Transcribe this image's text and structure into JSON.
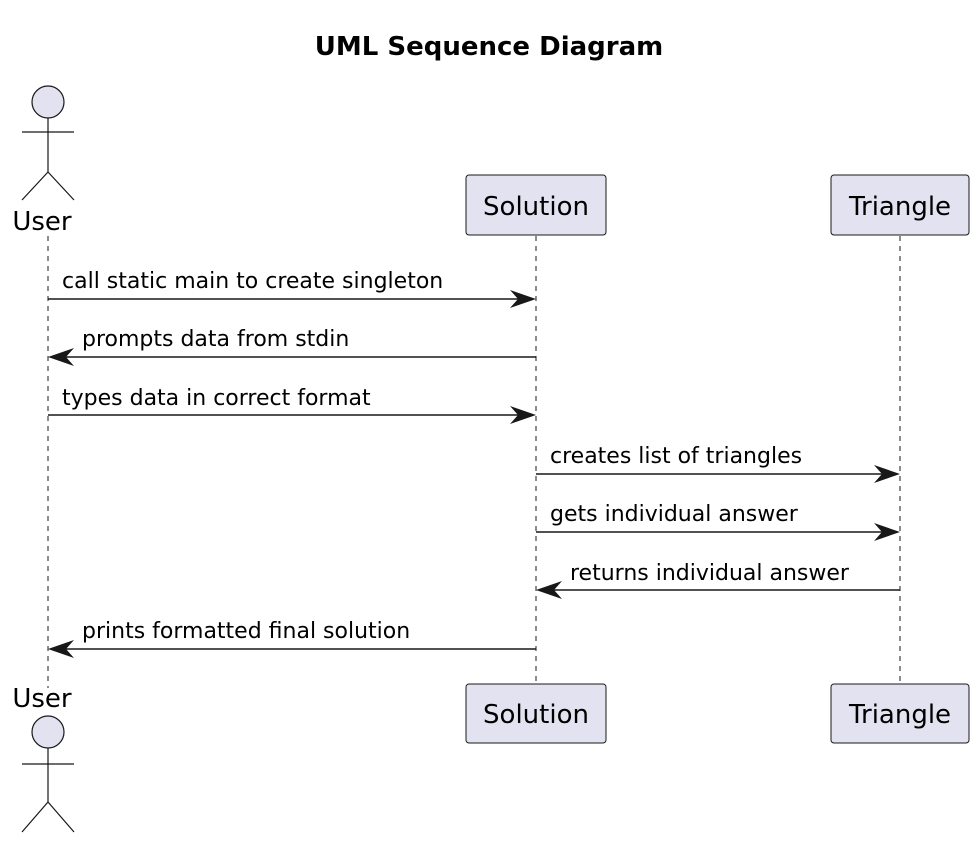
{
  "title": "UML Sequence Diagram",
  "participants": [
    {
      "id": "user",
      "label": "User",
      "kind": "actor"
    },
    {
      "id": "solution",
      "label": "Solution",
      "kind": "participant"
    },
    {
      "id": "triangle",
      "label": "Triangle",
      "kind": "participant"
    }
  ],
  "messages": [
    {
      "from": "user",
      "to": "solution",
      "label": "call static main to create singleton"
    },
    {
      "from": "solution",
      "to": "user",
      "label": "prompts data from stdin"
    },
    {
      "from": "user",
      "to": "solution",
      "label": "types data in correct format"
    },
    {
      "from": "solution",
      "to": "triangle",
      "label": "creates list of triangles"
    },
    {
      "from": "solution",
      "to": "triangle",
      "label": "gets individual answer"
    },
    {
      "from": "triangle",
      "to": "solution",
      "label": "returns individual answer"
    },
    {
      "from": "solution",
      "to": "user",
      "label": "prints formatted final solution"
    }
  ],
  "colors": {
    "participant_fill": "#e2e2f0",
    "stroke": "#181818",
    "background": "#ffffff"
  }
}
